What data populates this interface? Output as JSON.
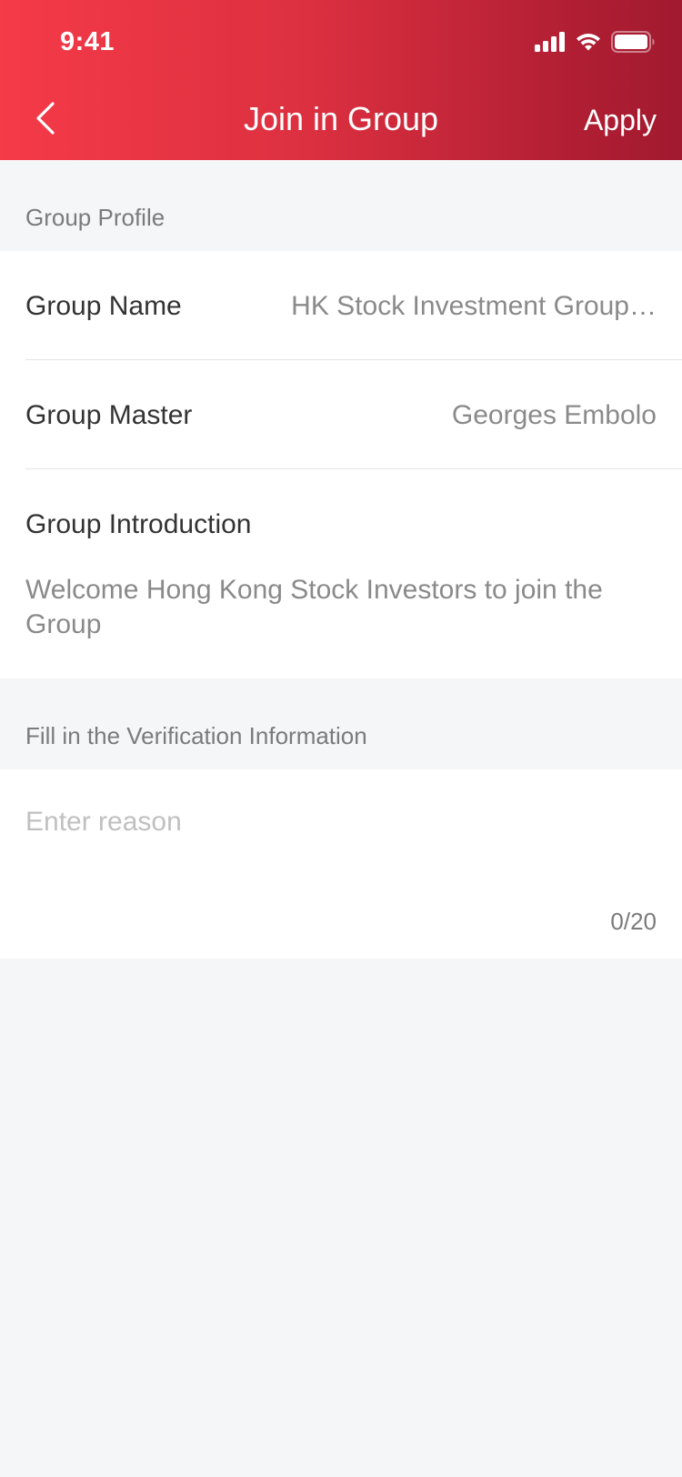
{
  "status_bar": {
    "time": "9:41"
  },
  "nav": {
    "title": "Join in Group",
    "apply_label": "Apply"
  },
  "profile": {
    "section_label": "Group Profile",
    "name_label": "Group Name",
    "name_value": "HK Stock Investment Group…",
    "master_label": "Group Master",
    "master_value": "Georges Embolo",
    "intro_label": "Group Introduction",
    "intro_text": "Welcome Hong Kong Stock Investors to join the Group"
  },
  "verification": {
    "section_label": "Fill in the Verification Information",
    "placeholder": "Enter reason",
    "counter": "0/20"
  },
  "colors": {
    "header_gradient_start": "#f53a48",
    "header_gradient_end": "#a11a2f",
    "page_background": "#f5f6f8"
  },
  "icons": [
    "signal-icon",
    "wifi-icon",
    "battery-icon",
    "back-chevron-icon"
  ]
}
